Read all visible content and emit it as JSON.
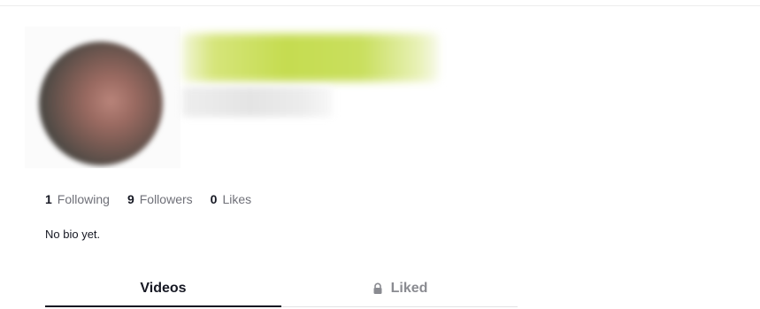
{
  "profile": {
    "stats": [
      {
        "count": "1",
        "label": "Following"
      },
      {
        "count": "9",
        "label": "Followers"
      },
      {
        "count": "0",
        "label": "Likes"
      }
    ],
    "bio": "No bio yet."
  },
  "tabs": [
    {
      "label": "Videos",
      "active": true,
      "icon": ""
    },
    {
      "label": "Liked",
      "active": false,
      "icon": "lock-icon"
    }
  ],
  "colors": {
    "text_primary": "#161823",
    "text_secondary": "#6f7078",
    "tab_inactive": "#8a8b91",
    "name_highlight": "#c5dc50"
  }
}
